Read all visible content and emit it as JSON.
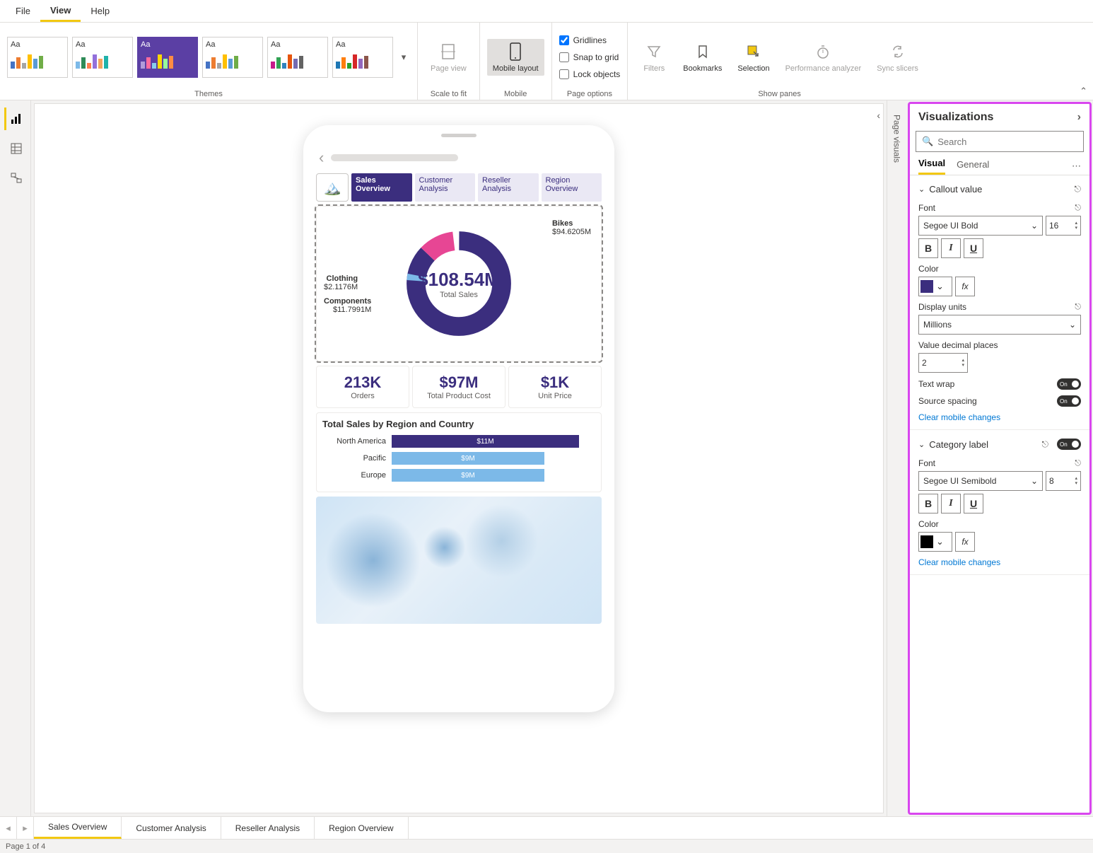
{
  "menubar": {
    "file": "File",
    "view": "View",
    "help": "Help"
  },
  "ribbon": {
    "themes_label": "Themes",
    "theme_aa": "Aa",
    "scale_to_fit": {
      "btn": "Page view",
      "label": "Scale to fit"
    },
    "mobile": {
      "btn": "Mobile layout",
      "label": "Mobile"
    },
    "page_options": {
      "gridlines": "Gridlines",
      "snap": "Snap to grid",
      "lock": "Lock objects",
      "label": "Page options"
    },
    "panes": {
      "filters": "Filters",
      "bookmarks": "Bookmarks",
      "selection": "Selection",
      "perf": "Performance analyzer",
      "sync": "Sync slicers",
      "label": "Show panes"
    }
  },
  "vrail": "Page visuals",
  "phone": {
    "tabs": {
      "t1": "Sales Overview",
      "t2": "Customer Analysis",
      "t3": "Reseller Analysis",
      "t4": "Region Overview"
    },
    "donut": {
      "center_value": "$108.54M",
      "center_label": "Total Sales",
      "bikes": "Bikes",
      "bikes_val": "$94.6205M",
      "clothing": "Clothing",
      "clothing_val": "$2.1176M",
      "components": "Components",
      "components_val": "$11.7991M"
    },
    "kpis": {
      "k1v": "213K",
      "k1l": "Orders",
      "k2v": "$97M",
      "k2l": "Total Product Cost",
      "k3v": "$1K",
      "k3l": "Unit Price"
    },
    "region_title": "Total Sales by Region and Country",
    "bars": {
      "na": "North America",
      "na_v": "$11M",
      "pa": "Pacific",
      "pa_v": "$9M",
      "eu": "Europe",
      "eu_v": "$9M"
    }
  },
  "viz": {
    "title": "Visualizations",
    "search_ph": "Search",
    "tab_visual": "Visual",
    "tab_general": "General",
    "sec_callout": "Callout value",
    "font_label": "Font",
    "font_family_1": "Segoe UI Bold",
    "font_size_1": "16",
    "color_label": "Color",
    "color_val_1": "#3b2e7e",
    "display_units_label": "Display units",
    "display_units_val": "Millions",
    "decimals_label": "Value decimal places",
    "decimals_val": "2",
    "textwrap_label": "Text wrap",
    "textwrap_val": "On",
    "spacing_label": "Source spacing",
    "spacing_val": "On",
    "clear": "Clear mobile changes",
    "sec_category": "Category label",
    "category_toggle": "On",
    "font_family_2": "Segoe UI Semibold",
    "font_size_2": "8",
    "color_val_2": "#000000",
    "fx": "fx"
  },
  "pagetabs": {
    "p1": "Sales Overview",
    "p2": "Customer Analysis",
    "p3": "Reseller Analysis",
    "p4": "Region Overview"
  },
  "status": "Page 1 of 4",
  "chart_data": [
    {
      "type": "pie",
      "title": "Total Sales",
      "total": 108.54,
      "unit": "$M",
      "slices": [
        {
          "name": "Bikes",
          "value": 94.6205
        },
        {
          "name": "Components",
          "value": 11.7991
        },
        {
          "name": "Clothing",
          "value": 2.1176
        }
      ]
    },
    {
      "type": "bar",
      "title": "Total Sales by Region and Country",
      "categories": [
        "North America",
        "Pacific",
        "Europe"
      ],
      "values": [
        11,
        9,
        9
      ],
      "unit": "$M",
      "ylim": [
        0,
        12
      ]
    }
  ]
}
